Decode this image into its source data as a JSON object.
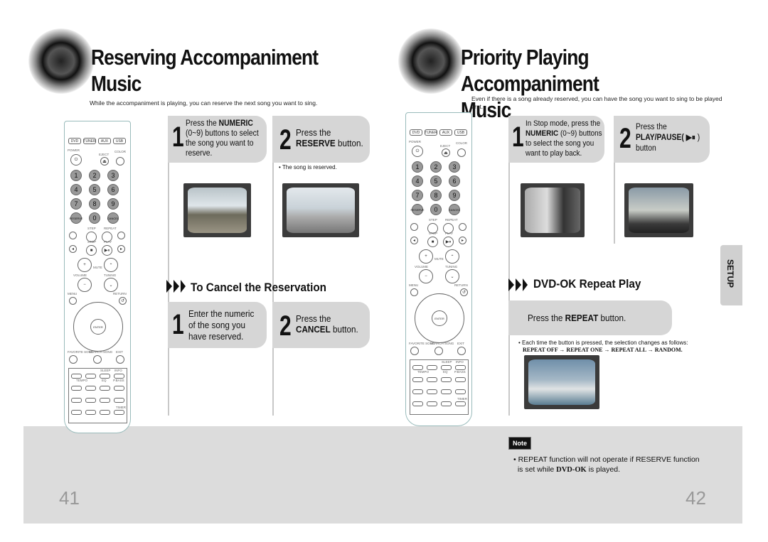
{
  "left": {
    "title_line1": "Reserving Accompaniment",
    "title_line2": "Music",
    "subtitle": "While the accompaniment is playing, you can reserve the next song you want to sing.",
    "step1": {
      "num": "1",
      "pre": "Press the ",
      "bold": "NUMERIC",
      "post1": "(0~9) buttons to select",
      "post2": "the song you want to",
      "post3": "reserve."
    },
    "step2": {
      "num": "2",
      "line1": "Press the",
      "bold": "RESERVE",
      "post": " button."
    },
    "step2_note": "The song is reserved.",
    "cancel_header": "To Cancel the Reservation",
    "cancel1": {
      "num": "1",
      "line1": "Enter the numeric",
      "line2": "of the song you",
      "line3": "have reserved."
    },
    "cancel2": {
      "num": "2",
      "line1": "Press the",
      "bold": "CANCEL",
      "post": " button."
    },
    "page_number": "41"
  },
  "right": {
    "title_line1": "Priority Playing Accompaniment",
    "title_line2": "Music",
    "subtitle": "Even if there is a song already reserved, you can have the song you want to sing to be played first.",
    "step1": {
      "num": "1",
      "line1": "In Stop mode, press the",
      "bold": "NUMERIC",
      "post1": " (0~9) buttons",
      "post2": "to select the song you",
      "post3": "want to play back."
    },
    "step2": {
      "num": "2",
      "line1": "Press the",
      "bold": "PLAY/PAUSE(",
      "icon": "▶⏸",
      "close": " )",
      "line3": "button"
    },
    "repeat_header": "DVD-OK Repeat Play",
    "repeat_step": {
      "pre": "Press the ",
      "bold": "REPEAT",
      "post": " button."
    },
    "repeat_note": "Each time the button is pressed, the selection changes as follows:",
    "repeat_sequence": "REPEAT OFF → REPEAT ONE → REPEAT ALL → RANDOM.",
    "side_tab": "SETUP",
    "note_label": "Note",
    "note_line1": "REPEAT function will not operate if RESERVE function",
    "note_line2_pre": "is set while ",
    "note_line2_bold": "DVD-OK",
    "note_line2_post": " is played.",
    "page_number": "42"
  },
  "remote": {
    "modes": [
      "DVD",
      "TUNER",
      "AUX",
      "USB"
    ],
    "labels": {
      "power": "POWER",
      "eject": "EJECT",
      "color": "COLOR",
      "step": "STEP",
      "repeat": "REPEAT",
      "stop": "STOP",
      "play": "PLAY",
      "mute": "MUTE",
      "volume": "VOLUME",
      "tuning": "TUNING",
      "menu": "MENU",
      "return": "RETURN",
      "enter": "ENTER",
      "favorite": "FAVORITE SONG",
      "search": "SEARCH SONG",
      "exit": "EXIT",
      "sleep": "SLEEP",
      "info": "INFO",
      "tempo": "TEMPO",
      "eq": "EQ",
      "pl2": "P.BASS",
      "timer": "TIMER"
    },
    "digits": [
      "1",
      "2",
      "3",
      "4",
      "5",
      "6",
      "7",
      "8",
      "9",
      "RESERVE",
      "0",
      "CANCEL"
    ]
  },
  "colors": {
    "step_bg": "#d6d6d6",
    "band": "#dcdcdc",
    "page_number": "#999999"
  }
}
